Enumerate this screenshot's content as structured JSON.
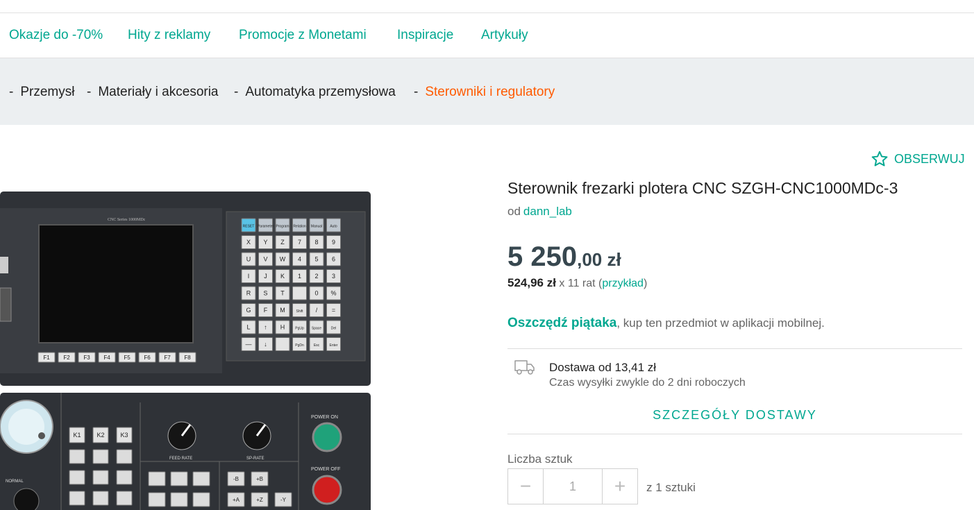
{
  "nav": {
    "items": [
      {
        "label": "Okazje do -70%"
      },
      {
        "label": "Hity z reklamy"
      },
      {
        "label": "Promocje z Monetami"
      },
      {
        "label": "Inspiracje"
      },
      {
        "label": "Artykuły"
      }
    ]
  },
  "breadcrumb": {
    "separator": "-",
    "items": [
      {
        "label": "Przemysł"
      },
      {
        "label": "Materiały i akcesoria"
      },
      {
        "label": "Automatyka przemysłowa"
      },
      {
        "label": "Sterowniki i regulatory"
      }
    ]
  },
  "product": {
    "follow_label": "OBSERWUJ",
    "title": "Sterownik frezarki plotera CNC SZGH-CNC1000MDc-3",
    "seller_prefix": "od",
    "seller_name": "dann_lab",
    "price_main": "5 250",
    "price_decimal": ",00 zł",
    "installment_amount": "524,96 zł",
    "installment_text": "x 11 rat",
    "installment_link": "przykład",
    "promo_bold": "Oszczędź piątaka",
    "promo_text": ", kup ten przedmiot w aplikacji mobilnej."
  },
  "delivery": {
    "line1": "Dostawa od 13,41 zł",
    "line2": "Czas wysyłki zwykle do 2 dni roboczych",
    "details_label": "SZCZEGÓŁY DOSTAWY"
  },
  "quantity": {
    "label": "Liczba sztuk",
    "value": "1",
    "minus": "−",
    "plus": "+",
    "of_label": "z 1 sztuki"
  },
  "image": {
    "screen_caption": "CNC Series 1000MDc",
    "fkeys": [
      "F1",
      "F2",
      "F3",
      "F4",
      "F5",
      "F6",
      "F7",
      "F8"
    ],
    "keys": [
      "RESET",
      "Parameter",
      "Program",
      "Relation",
      "Manual",
      "Auto",
      "X",
      "Y",
      "Z",
      "7",
      "8",
      "9",
      "U",
      "V",
      "W",
      "4",
      "5",
      "6",
      "I",
      "J",
      "K",
      "1",
      "2",
      "3",
      "R",
      "S",
      "T",
      "",
      "0",
      "%",
      "G",
      "F",
      "M",
      "Shift",
      "/",
      "=",
      "L",
      "↑",
      "H",
      "PgUp",
      "Space",
      "Del",
      "—",
      "↓",
      "",
      "PgDn",
      "Esc",
      "Enter"
    ],
    "knob1": "FEED RATE",
    "knob2": "SP-RATE",
    "power_on": "POWER ON",
    "power_off": "POWER OFF",
    "k_keys": [
      "K1",
      "K2",
      "K3"
    ],
    "axis_keys": [
      "-B",
      "+B",
      "+A",
      "+Z",
      "-Y"
    ],
    "mode_label": "NORMAL"
  },
  "colors": {
    "accent": "#00a790",
    "breadcrumb_active": "#ff5a00",
    "price": "#37474f"
  }
}
